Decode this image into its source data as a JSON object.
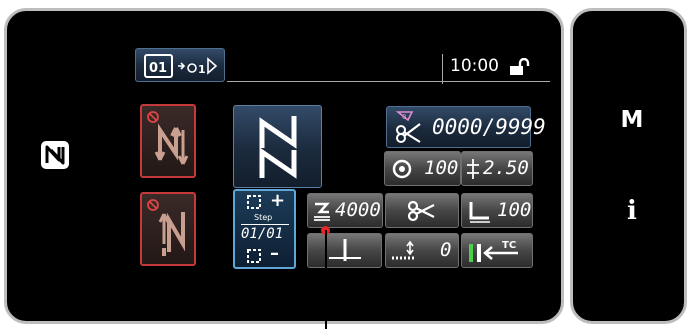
{
  "device": {
    "right_panel": {
      "m_label": "M",
      "info_label": "i"
    }
  },
  "header": {
    "clock": "10:00"
  },
  "counter": {
    "value": "0000/9999"
  },
  "stitch": {
    "speed": "100",
    "length": "2.50"
  },
  "step": {
    "plus_label": "+",
    "title": "Step",
    "value": "01/01",
    "minus_label": "–"
  },
  "parameters": {
    "max_speed": "4000",
    "presser_foot": "100",
    "bobbin_value": "0"
  },
  "colors": {
    "panel_border": "#bdbdbd",
    "button_blue": "#1b2a3d",
    "button_gray": "#464646",
    "warning_red": "#c43a3a",
    "highlight_blue": "#5fa7d8",
    "counter_pink": "#e08bd0",
    "callout_red": "#e32727"
  },
  "icons": [
    "nfc-icon",
    "pattern-select-icon",
    "lock-open-icon",
    "reverse-start-disabled-icon",
    "reverse-end-disabled-icon",
    "sewing-pattern-icon",
    "counter-icon",
    "scissors-icon",
    "speed-icon",
    "stitch-length-icon",
    "max-speed-icon",
    "thread-trim-icon",
    "presser-foot-icon",
    "needle-position-icon",
    "bobbin-icon",
    "thread-clamp-icon"
  ]
}
